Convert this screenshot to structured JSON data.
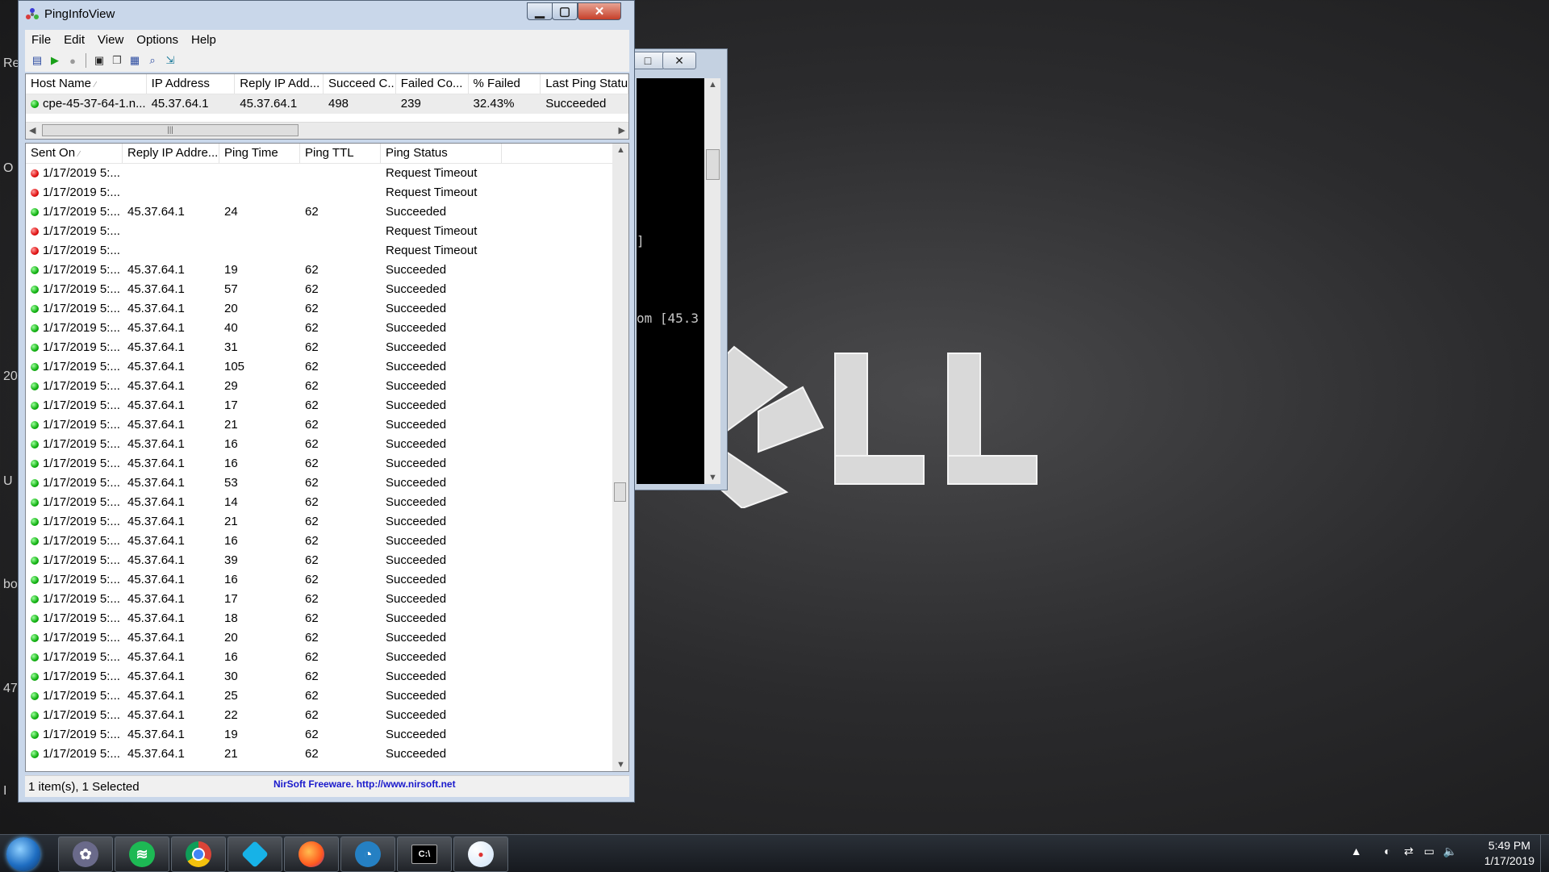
{
  "desktop": {
    "edge_fragments": [
      "Re",
      "O",
      "20",
      "U",
      "bo",
      "47",
      "I"
    ],
    "wallpaper_logo_text": "DELL"
  },
  "console": {
    "lines": [
      "",
      "",
      "",
      "",
      "",
      "",
      "",
      "",
      "]",
      "",
      "",
      "",
      "om [45.3"
    ],
    "buttons": [
      "□",
      "✕"
    ]
  },
  "window": {
    "title": "PingInfoView",
    "menu": [
      "File",
      "Edit",
      "View",
      "Options",
      "Help"
    ],
    "toolbar_icons": [
      "properties-icon",
      "start-icon",
      "stop-icon",
      "save-icon",
      "copy-icon",
      "report-icon",
      "find-icon",
      "exit-icon"
    ],
    "hosts": {
      "columns": [
        "Host Name",
        "IP Address",
        "Reply IP Add...",
        "Succeed C...",
        "Failed Co...",
        "% Failed",
        "Last Ping Status"
      ],
      "rows": [
        {
          "status": "green",
          "cells": [
            "cpe-45-37-64-1.n...",
            "45.37.64.1",
            "45.37.64.1",
            "498",
            "239",
            "32.43%",
            "Succeeded"
          ]
        }
      ]
    },
    "log": {
      "columns": [
        "Sent On",
        "Reply IP Addre...",
        "Ping Time",
        "Ping TTL",
        "Ping Status"
      ],
      "rows": [
        {
          "status": "red",
          "cells": [
            "1/17/2019 5:...",
            "",
            "",
            "",
            "Request Timeout"
          ]
        },
        {
          "status": "red",
          "cells": [
            "1/17/2019 5:...",
            "",
            "",
            "",
            "Request Timeout"
          ]
        },
        {
          "status": "green",
          "cells": [
            "1/17/2019 5:...",
            "45.37.64.1",
            "24",
            "62",
            "Succeeded"
          ]
        },
        {
          "status": "red",
          "cells": [
            "1/17/2019 5:...",
            "",
            "",
            "",
            "Request Timeout"
          ]
        },
        {
          "status": "red",
          "cells": [
            "1/17/2019 5:...",
            "",
            "",
            "",
            "Request Timeout"
          ]
        },
        {
          "status": "green",
          "cells": [
            "1/17/2019 5:...",
            "45.37.64.1",
            "19",
            "62",
            "Succeeded"
          ]
        },
        {
          "status": "green",
          "cells": [
            "1/17/2019 5:...",
            "45.37.64.1",
            "57",
            "62",
            "Succeeded"
          ]
        },
        {
          "status": "green",
          "cells": [
            "1/17/2019 5:...",
            "45.37.64.1",
            "20",
            "62",
            "Succeeded"
          ]
        },
        {
          "status": "green",
          "cells": [
            "1/17/2019 5:...",
            "45.37.64.1",
            "40",
            "62",
            "Succeeded"
          ]
        },
        {
          "status": "green",
          "cells": [
            "1/17/2019 5:...",
            "45.37.64.1",
            "31",
            "62",
            "Succeeded"
          ]
        },
        {
          "status": "green",
          "cells": [
            "1/17/2019 5:...",
            "45.37.64.1",
            "105",
            "62",
            "Succeeded"
          ]
        },
        {
          "status": "green",
          "cells": [
            "1/17/2019 5:...",
            "45.37.64.1",
            "29",
            "62",
            "Succeeded"
          ]
        },
        {
          "status": "green",
          "cells": [
            "1/17/2019 5:...",
            "45.37.64.1",
            "17",
            "62",
            "Succeeded"
          ]
        },
        {
          "status": "green",
          "cells": [
            "1/17/2019 5:...",
            "45.37.64.1",
            "21",
            "62",
            "Succeeded"
          ]
        },
        {
          "status": "green",
          "cells": [
            "1/17/2019 5:...",
            "45.37.64.1",
            "16",
            "62",
            "Succeeded"
          ]
        },
        {
          "status": "green",
          "cells": [
            "1/17/2019 5:...",
            "45.37.64.1",
            "16",
            "62",
            "Succeeded"
          ]
        },
        {
          "status": "green",
          "cells": [
            "1/17/2019 5:...",
            "45.37.64.1",
            "53",
            "62",
            "Succeeded"
          ]
        },
        {
          "status": "green",
          "cells": [
            "1/17/2019 5:...",
            "45.37.64.1",
            "14",
            "62",
            "Succeeded"
          ]
        },
        {
          "status": "green",
          "cells": [
            "1/17/2019 5:...",
            "45.37.64.1",
            "21",
            "62",
            "Succeeded"
          ]
        },
        {
          "status": "green",
          "cells": [
            "1/17/2019 5:...",
            "45.37.64.1",
            "16",
            "62",
            "Succeeded"
          ]
        },
        {
          "status": "green",
          "cells": [
            "1/17/2019 5:...",
            "45.37.64.1",
            "39",
            "62",
            "Succeeded"
          ]
        },
        {
          "status": "green",
          "cells": [
            "1/17/2019 5:...",
            "45.37.64.1",
            "16",
            "62",
            "Succeeded"
          ]
        },
        {
          "status": "green",
          "cells": [
            "1/17/2019 5:...",
            "45.37.64.1",
            "17",
            "62",
            "Succeeded"
          ]
        },
        {
          "status": "green",
          "cells": [
            "1/17/2019 5:...",
            "45.37.64.1",
            "18",
            "62",
            "Succeeded"
          ]
        },
        {
          "status": "green",
          "cells": [
            "1/17/2019 5:...",
            "45.37.64.1",
            "20",
            "62",
            "Succeeded"
          ]
        },
        {
          "status": "green",
          "cells": [
            "1/17/2019 5:...",
            "45.37.64.1",
            "16",
            "62",
            "Succeeded"
          ]
        },
        {
          "status": "green",
          "cells": [
            "1/17/2019 5:...",
            "45.37.64.1",
            "30",
            "62",
            "Succeeded"
          ]
        },
        {
          "status": "green",
          "cells": [
            "1/17/2019 5:...",
            "45.37.64.1",
            "25",
            "62",
            "Succeeded"
          ]
        },
        {
          "status": "green",
          "cells": [
            "1/17/2019 5:...",
            "45.37.64.1",
            "22",
            "62",
            "Succeeded"
          ]
        },
        {
          "status": "green",
          "cells": [
            "1/17/2019 5:...",
            "45.37.64.1",
            "19",
            "62",
            "Succeeded"
          ]
        },
        {
          "status": "green",
          "cells": [
            "1/17/2019 5:...",
            "45.37.64.1",
            "21",
            "62",
            "Succeeded"
          ]
        }
      ]
    },
    "status_left": "1 item(s), 1 Selected",
    "status_link": "NirSoft Freeware.  http://www.nirsoft.net"
  },
  "taskbar": {
    "apps": [
      "pinginfoview-icon",
      "spotify-icon",
      "chrome-icon",
      "kodi-icon",
      "firefox-icon",
      "teamspeak-icon",
      "cmd-icon",
      "paint-icon"
    ],
    "clock_time": "5:49 PM",
    "clock_date": "1/17/2019"
  },
  "colors": {
    "status_green": "#10b010",
    "status_red": "#e01010",
    "link_blue": "#1a1acc"
  }
}
